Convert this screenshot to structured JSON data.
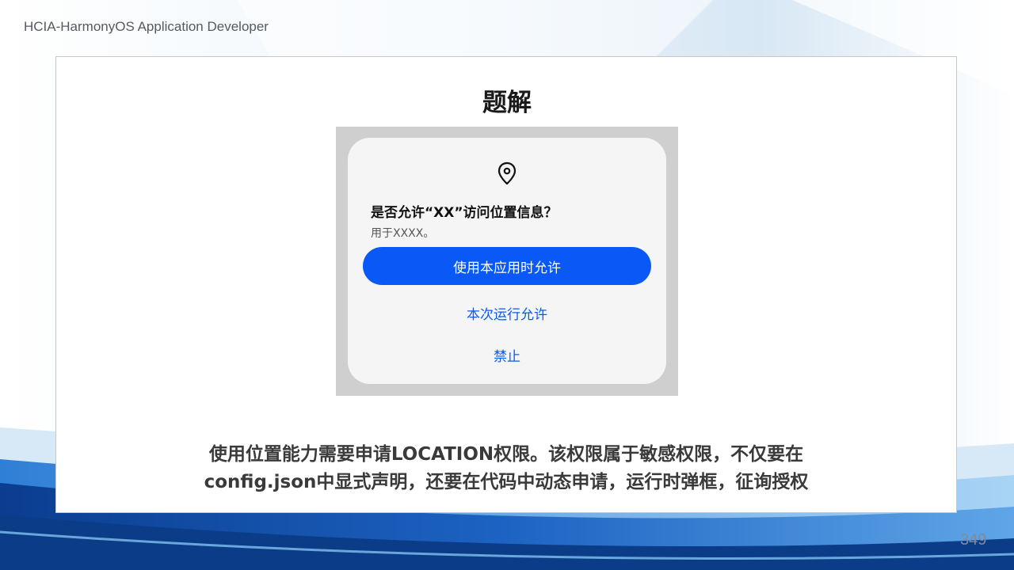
{
  "header": {
    "text": "HCIA-HarmonyOS Application Developer"
  },
  "slide": {
    "title": "题解",
    "dialog": {
      "icon": "location-pin-icon",
      "title": "是否允许“XX”访问位置信息？",
      "subtitle": "用于XXXX。",
      "primary_button": "使用本应用时允许",
      "secondary_button": "本次运行允许",
      "deny_button": "禁止",
      "accent_color": "#0A59F7"
    },
    "caption_line1": "使用位置能力需要申请LOCATION权限。该权限属于敏感权限，不仅要在",
    "caption_line2": "config.json中显式声明，还要在代码中动态申请，运行时弹框，征询授权"
  },
  "page_number": "349"
}
